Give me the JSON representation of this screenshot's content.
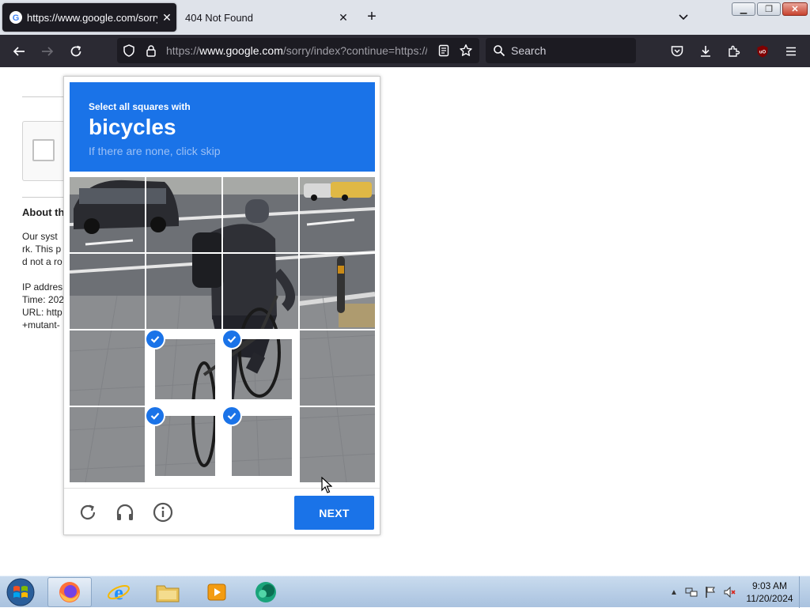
{
  "browser": {
    "tabs": [
      {
        "title": "https://www.google.com/sorry/index?continue=https",
        "active": true
      },
      {
        "title": "404 Not Found",
        "active": false
      }
    ],
    "url": {
      "prefix": "https://",
      "host": "www.google.com",
      "rest": "/sorry/index?continue=https://"
    },
    "search_placeholder": "Search"
  },
  "page": {
    "about_heading": "About th",
    "lines": [
      "Our syst",
      "rk. This p",
      "d not a ro",
      "IP addres",
      "Time: 202",
      "URL: http",
      "+mutant-"
    ]
  },
  "captcha": {
    "instruction": "Select all squares with",
    "object": "bicycles",
    "subtext": "If there are none, click skip",
    "selected_tiles": [
      9,
      10,
      13,
      14
    ],
    "next_label": "NEXT",
    "colors": {
      "accent": "#1a73e8"
    }
  },
  "taskbar": {
    "apps": [
      "firefox",
      "internet-explorer",
      "file-explorer",
      "media-player",
      "other-app"
    ],
    "time": "9:03 AM",
    "date": "11/20/2024"
  }
}
